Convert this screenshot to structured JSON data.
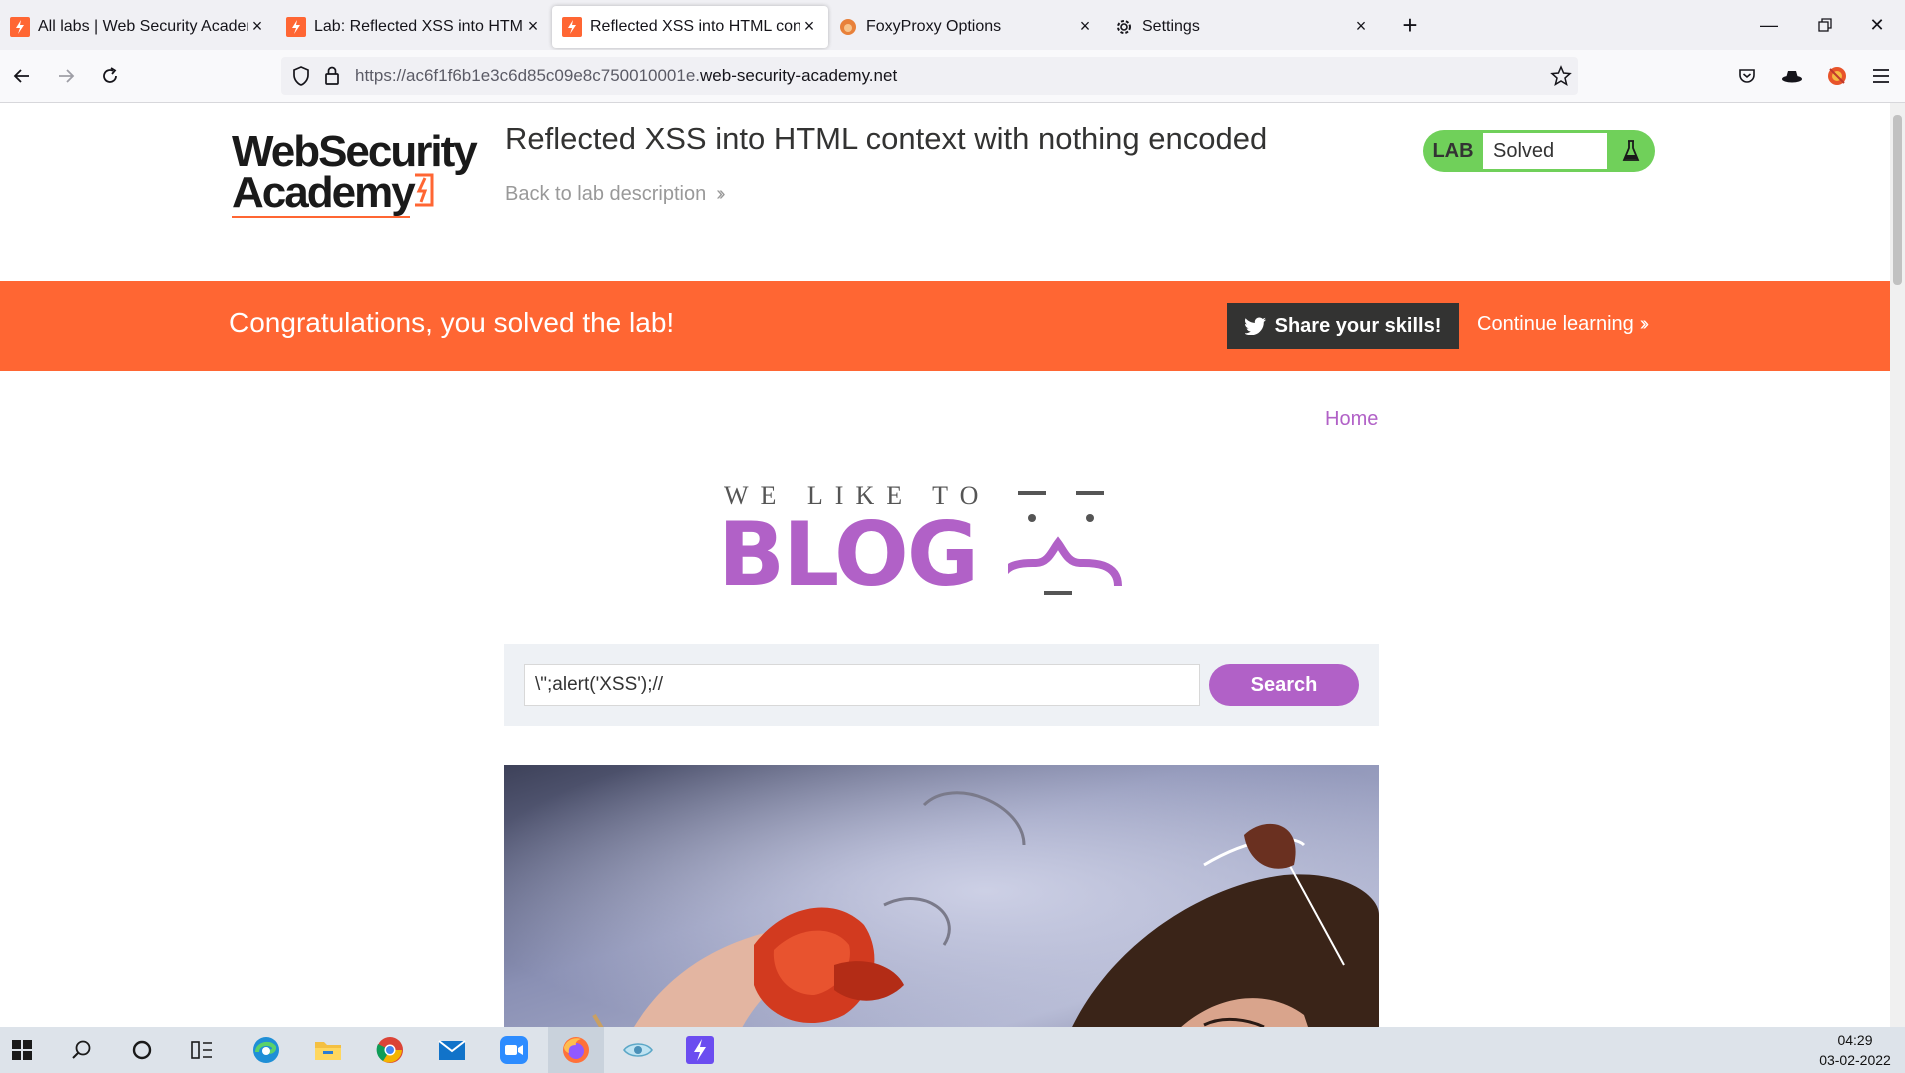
{
  "browser": {
    "tabs": [
      {
        "label": "All labs | Web Security Academy",
        "active": false
      },
      {
        "label": "Lab: Reflected XSS into HTML c",
        "active": false
      },
      {
        "label": "Reflected XSS into HTML conte",
        "active": true
      },
      {
        "label": "FoxyProxy Options",
        "active": false
      },
      {
        "label": "Settings",
        "active": false
      }
    ],
    "url_prefix": "https://ac6f1f6b1e3c6d85c09e8c750010001e.",
    "url_host": "web-security-academy.net"
  },
  "header": {
    "logo_line1": "WebSecurity",
    "logo_line2": "Academy",
    "lab_title": "Reflected XSS into HTML context with nothing encoded",
    "back_link": "Back to lab description",
    "lab_tag": "LAB",
    "lab_status": "Solved"
  },
  "banner": {
    "message": "Congratulations, you solved the lab!",
    "share_label": "Share your skills!",
    "continue_label": "Continue learning"
  },
  "blog": {
    "home_link": "Home",
    "tagline": "WE LIKE TO",
    "logo_word": "BLOG",
    "search_value": "\\\";alert('XSS');//",
    "search_button": "Search"
  },
  "taskbar": {
    "time": "04:29",
    "date": "03-02-2022"
  },
  "colors": {
    "accent_orange": "#ff6633",
    "blog_purple": "#b161c7",
    "lab_green": "#70d05a"
  }
}
